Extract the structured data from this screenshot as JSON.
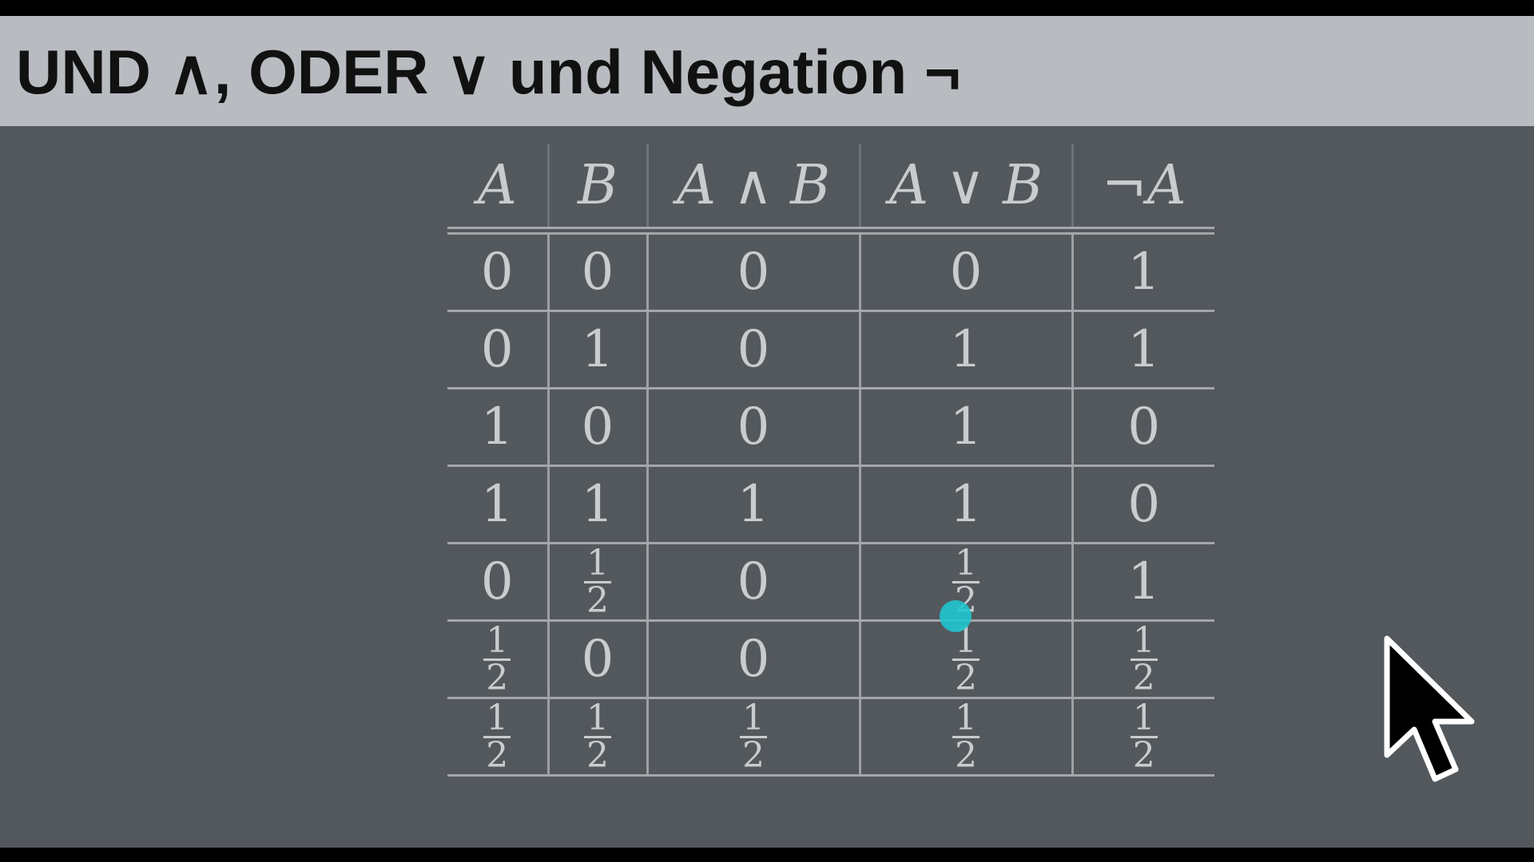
{
  "title": "UND ∧, ODER ∨ und Negation ¬",
  "table": {
    "headers": [
      "A",
      "B",
      "A ∧ B",
      "A ∨ B",
      "¬A"
    ],
    "rows": [
      [
        "0",
        "0",
        "0",
        "0",
        "1"
      ],
      [
        "0",
        "1",
        "0",
        "1",
        "1"
      ],
      [
        "1",
        "0",
        "0",
        "1",
        "0"
      ],
      [
        "1",
        "1",
        "1",
        "1",
        "0"
      ],
      [
        "0",
        "1/2",
        "0",
        "1/2",
        "1"
      ],
      [
        "1/2",
        "0",
        "0",
        "1/2",
        "1/2"
      ],
      [
        "1/2",
        "1/2",
        "1/2",
        "1/2",
        "1/2"
      ]
    ]
  },
  "colors": {
    "title_bar": "#b8bcc0",
    "background": "#53585d",
    "table_text": "#c9cccf",
    "click_indicator": "#20c6cf"
  },
  "icons": {
    "pointer": "mouse-pointer-icon",
    "click": "click-indicator-icon"
  }
}
